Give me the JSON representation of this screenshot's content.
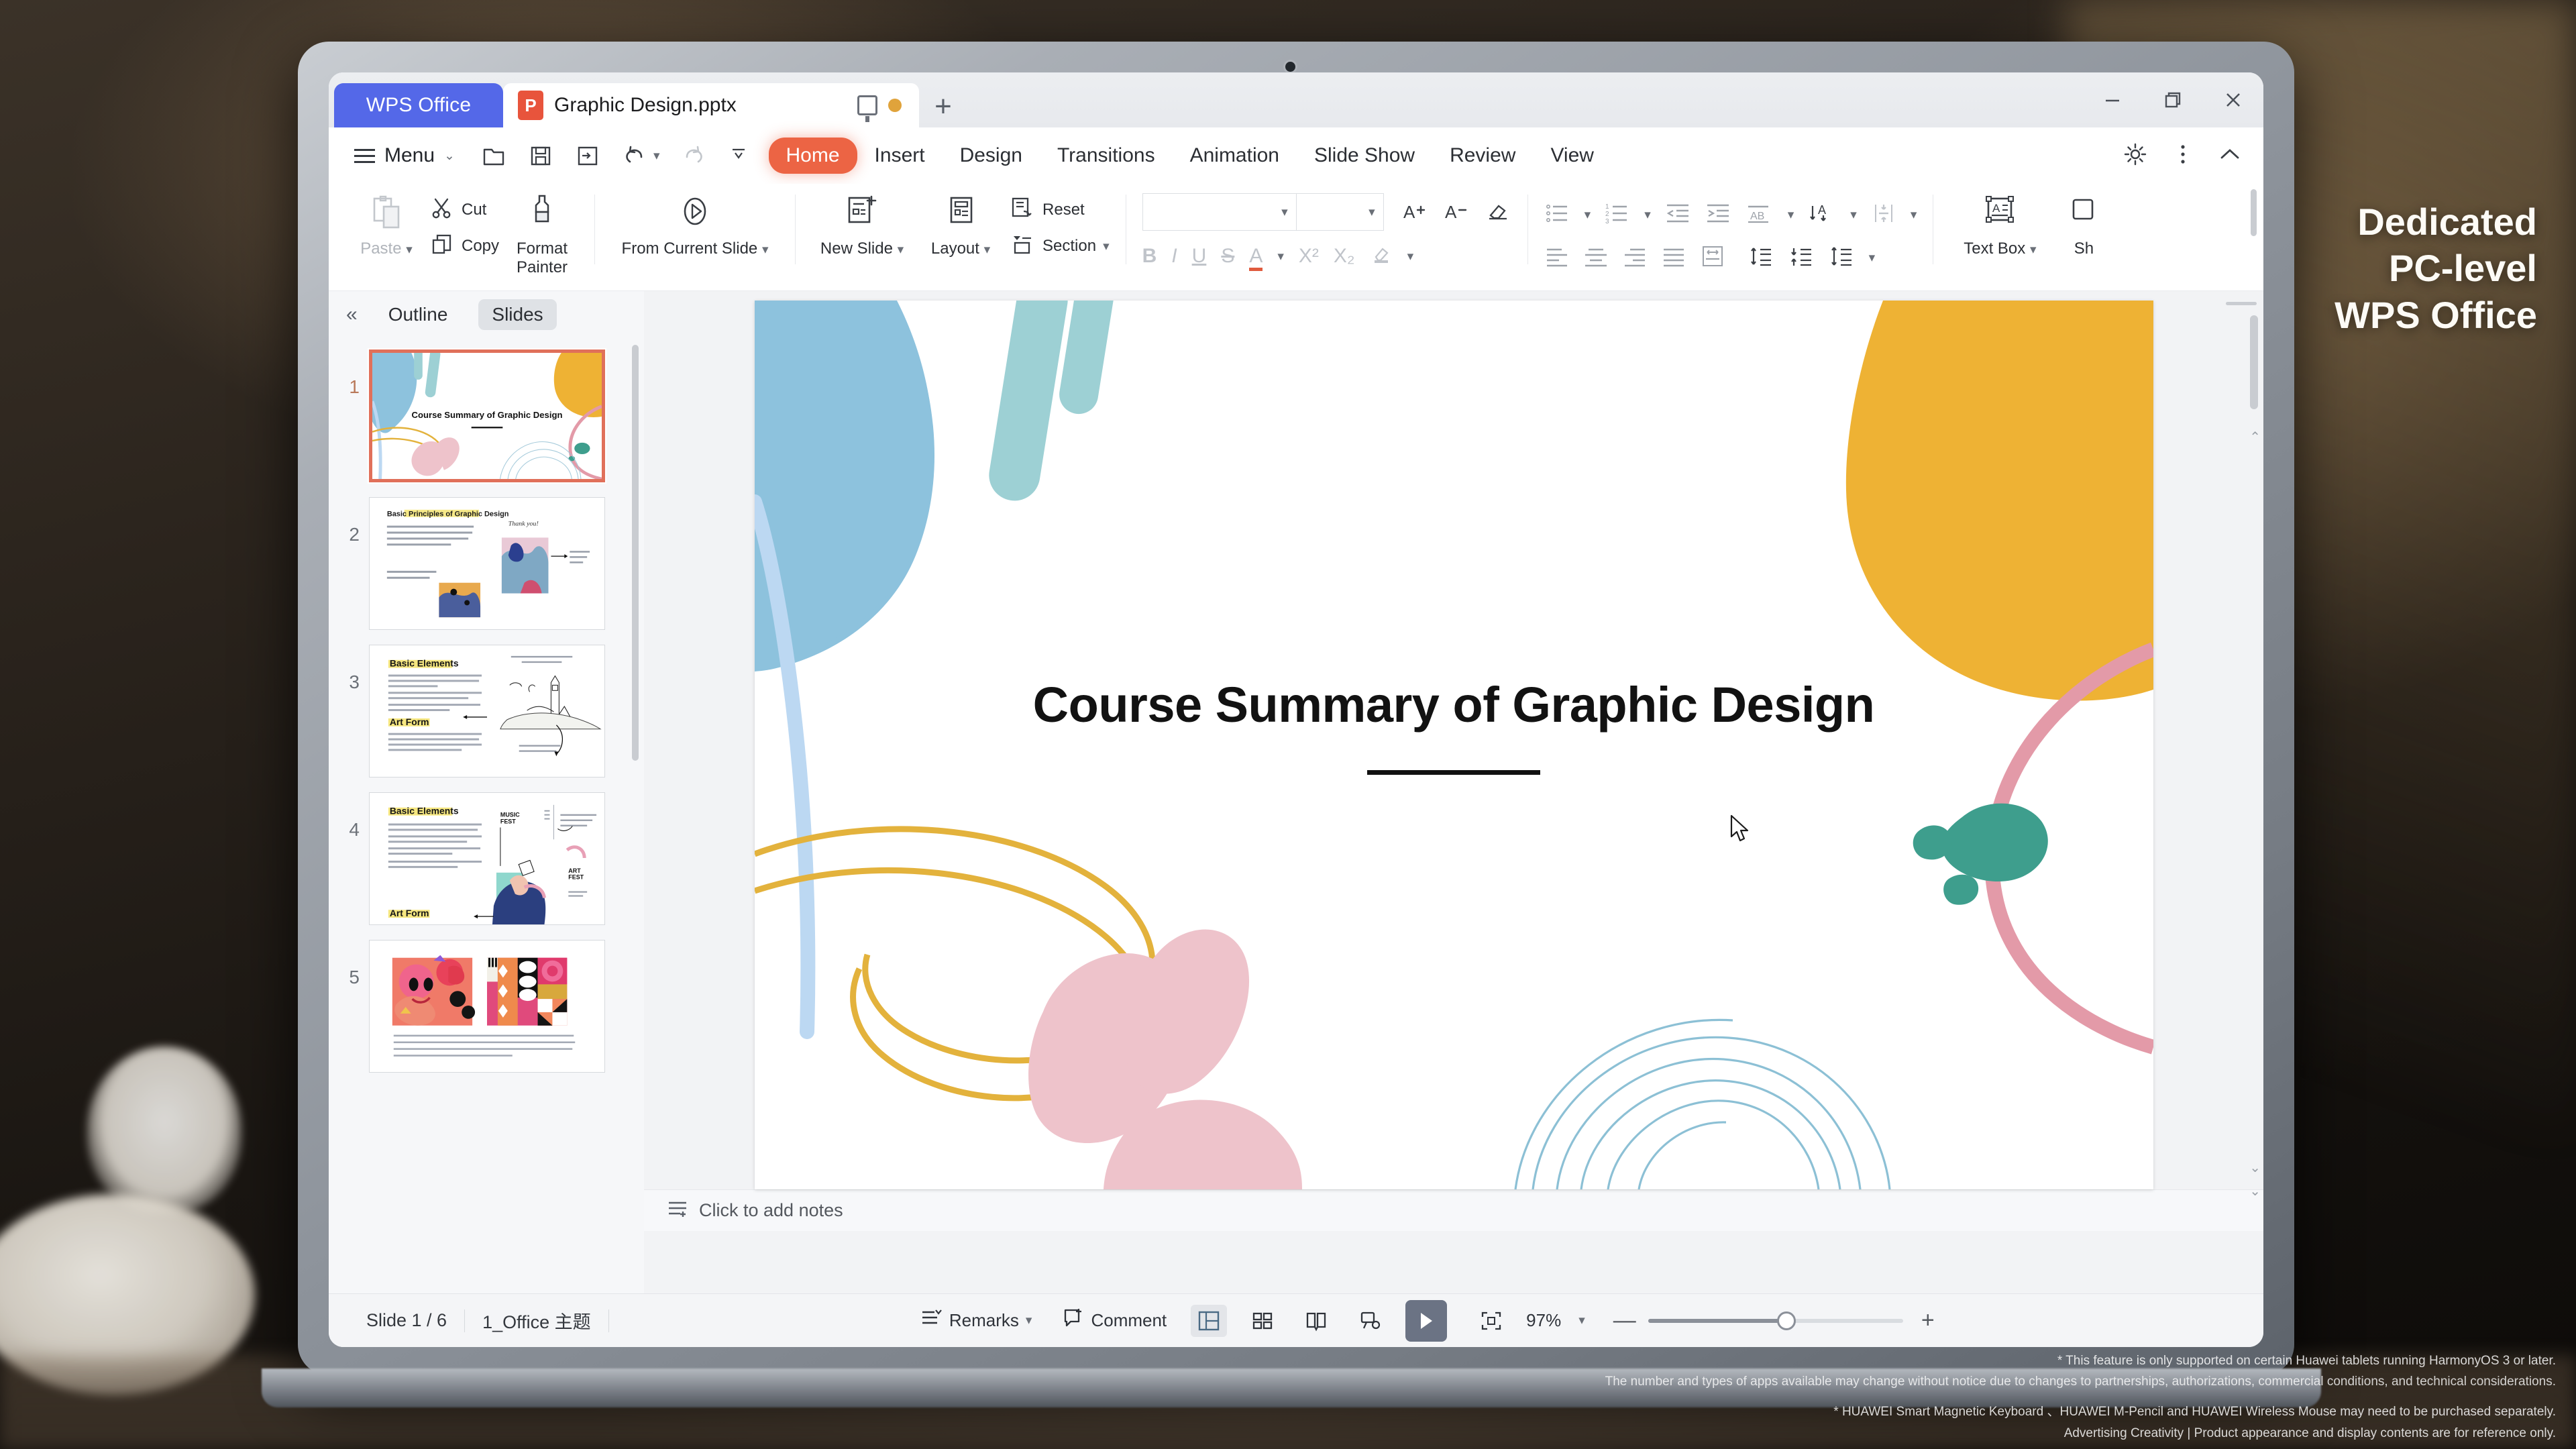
{
  "window": {
    "app_tab_label": "WPS Office",
    "doc_tab_label": "Graphic Design.pptx",
    "doc_icon_letter": "P",
    "new_tab_label": "+",
    "minimize_label": "—",
    "restore_label": "❐",
    "close_label": "✕"
  },
  "ribbon": {
    "menu_label": "Menu",
    "tabs": [
      {
        "label": "Home",
        "active": true
      },
      {
        "label": "Insert",
        "active": false
      },
      {
        "label": "Design",
        "active": false
      },
      {
        "label": "Transitions",
        "active": false
      },
      {
        "label": "Animation",
        "active": false
      },
      {
        "label": "Slide Show",
        "active": false
      },
      {
        "label": "Review",
        "active": false
      },
      {
        "label": "View",
        "active": false
      }
    ],
    "accent_color": "#ec6444"
  },
  "toolbar": {
    "paste_label": "Paste",
    "cut_label": "Cut",
    "copy_label": "Copy",
    "format_painter_label": "Format Painter",
    "from_current_slide_label": "From Current Slide",
    "new_slide_label": "New Slide",
    "layout_label": "Layout",
    "reset_label": "Reset",
    "section_label": "Section",
    "font_name_value": "",
    "font_size_value": "",
    "bold_label": "B",
    "italic_label": "I",
    "underline_label": "U",
    "strikethrough_label": "S",
    "font_color_label": "A",
    "superscript_label": "X²",
    "subscript_label": "X₂",
    "highlight_label": "A",
    "text_box_label": "Text Box",
    "shape_label": "Sh"
  },
  "slide_panel": {
    "collapse_label": "«",
    "tabs": [
      {
        "label": "Outline",
        "active": false
      },
      {
        "label": "Slides",
        "active": true
      }
    ],
    "thumbnails": [
      {
        "number": "1",
        "title": "Course Summary of Graphic Design",
        "selected": true
      },
      {
        "number": "2",
        "title": "Basic Principles of Graphic Design",
        "selected": false
      },
      {
        "number": "3",
        "title": "Basic Elements",
        "subtitle": "Art Form",
        "selected": false
      },
      {
        "number": "4",
        "title": "Basic Elements",
        "subtitle": "Art Form",
        "selected": false
      },
      {
        "number": "5",
        "title": "",
        "selected": false
      }
    ]
  },
  "slide": {
    "title": "Course Summary of Graphic Design",
    "colors": {
      "blue": "#8dc2dd",
      "teal": "#9dd0d4",
      "light_blue": "#bcd8f2",
      "yellow": "#eeb234",
      "pink": "#eec3cb",
      "rose": "#e39aa8",
      "green": "#3e9e8d",
      "gold_line": "#e3b23c",
      "thin_blue": "#86bdd3"
    }
  },
  "notes": {
    "placeholder": "Click to add notes"
  },
  "status": {
    "slide_counter": "Slide 1 / 6",
    "theme_name": "1_Office 主题",
    "remarks_label": "Remarks",
    "comment_label": "Comment",
    "zoom_label": "97%",
    "zoom_out_label": "—",
    "zoom_in_label": "+"
  },
  "marketing": {
    "line1": "Dedicated",
    "line2": "PC-level",
    "line3": "WPS Office"
  },
  "legal": {
    "line1": "* This feature is only supported on certain Huawei tablets running HarmonyOS 3 or later.",
    "line2": "The number and types of apps available may change without notice due to changes to partnerships, authorizations, commercial conditions, and technical considerations.",
    "line3": "* HUAWEI Smart Magnetic Keyboard 、HUAWEI M-Pencil and HUAWEI Wireless Mouse may need to be purchased separately.",
    "line4": "Advertising Creativity | Product appearance and  display contents are for reference only."
  }
}
